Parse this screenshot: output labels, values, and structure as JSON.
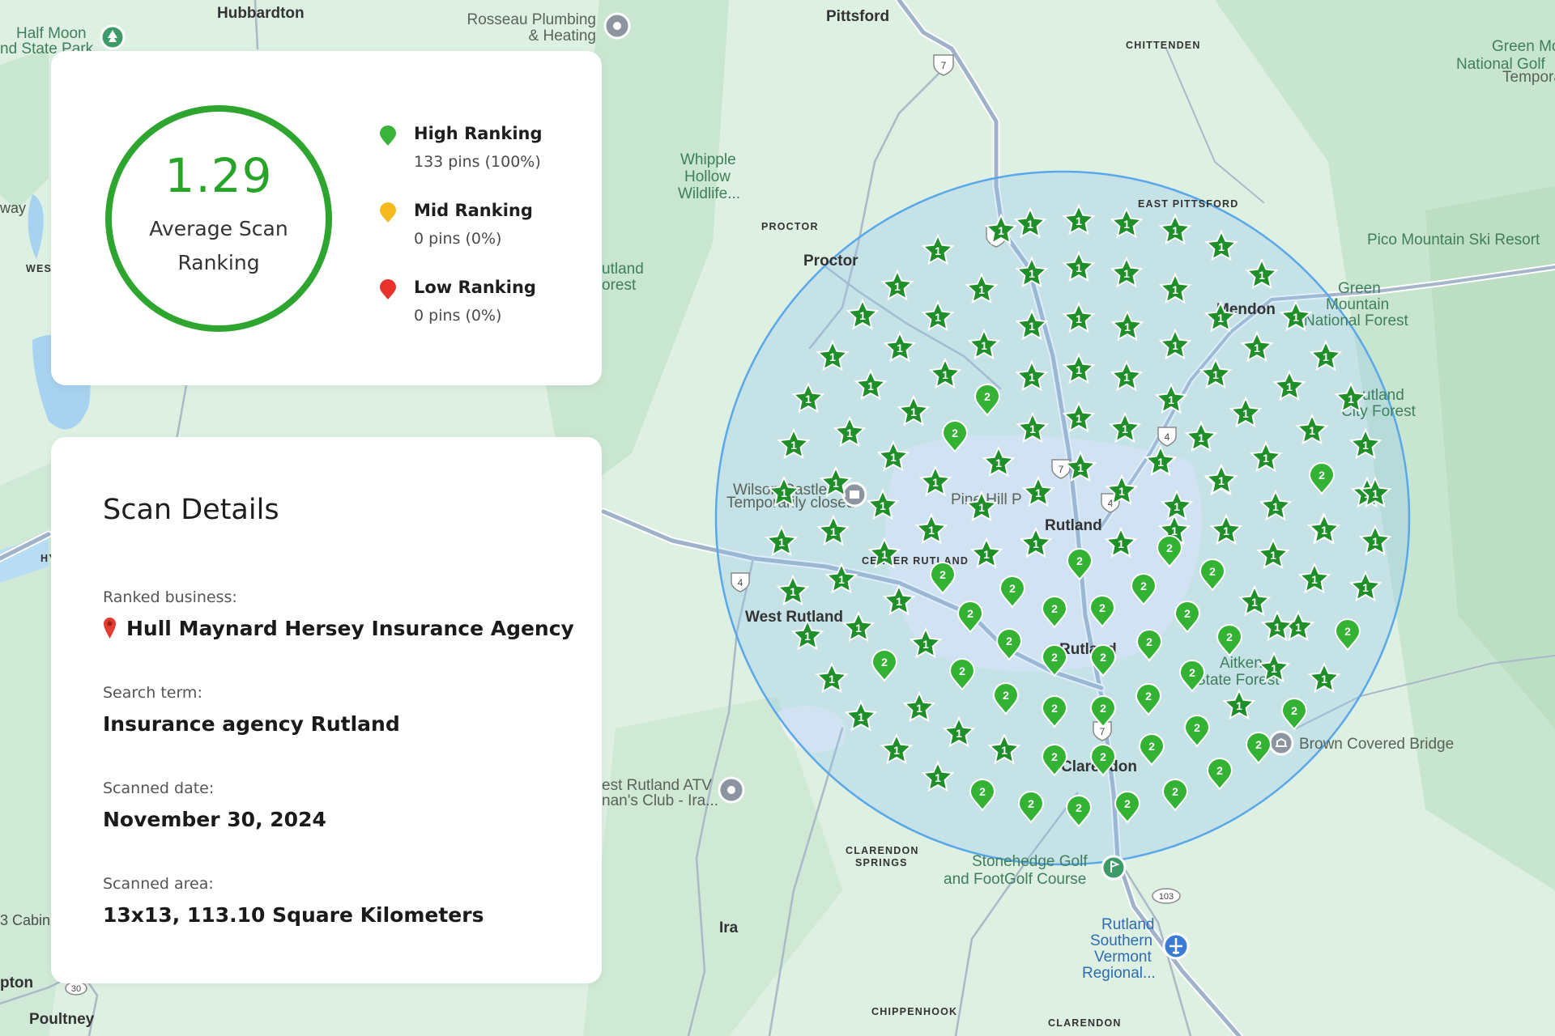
{
  "summary": {
    "score": "1.29",
    "score_caption": "Average Scan Ranking",
    "ring_color": "#2ea52e",
    "legend": [
      {
        "title": "High Ranking",
        "sub": "133 pins (100%)",
        "color": "#39b339"
      },
      {
        "title": "Mid Ranking",
        "sub": "0 pins (0%)",
        "color": "#f6b91e"
      },
      {
        "title": "Low Ranking",
        "sub": "0 pins (0%)",
        "color": "#e8322b"
      }
    ]
  },
  "details": {
    "title": "Scan Details",
    "business_label": "Ranked business:",
    "business_value": "Hull Maynard Hersey Insurance Agency",
    "search_label": "Search term:",
    "search_value": "Insurance agency Rutland",
    "date_label": "Scanned date:",
    "date_value": "November 30, 2024",
    "area_label": "Scanned area:",
    "area_value": "13x13, 113.10 Square Kilometers"
  },
  "map": {
    "place_labels": {
      "hubbardton": "Hubbardton",
      "half_moon_1": "Half Moon",
      "half_moon_2": "nd State Park",
      "rosseau_1": "Rosseau Plumbing",
      "rosseau_2": "& Heating",
      "pittsford": "Pittsford",
      "chittenden": "CHITTENDEN",
      "green_mtn_golf_1": "Green Mo",
      "green_mtn_golf_2": "National Golf",
      "green_mtn_golf_3": "Temporari",
      "way": "way",
      "wes": "WES",
      "whipple_1": "Whipple",
      "whipple_2": "Hollow",
      "whipple_3": "Wildlife...",
      "proctor_caps": "PROCTOR",
      "proctor": "Proctor",
      "east_pittsford": "EAST PITTSFORD",
      "pico": "Pico Mountain Ski Resort",
      "rutland_forest_1": "utland",
      "rutland_forest_2": "orest",
      "mendon": "Mendon",
      "gmnf_1": "Green",
      "gmnf_2": "Mountain",
      "gmnf_3": "National Forest",
      "city_forest_1": "utland",
      "city_forest_2": "City Forest",
      "wilson_1": "Wilson Castle",
      "wilson_2": "Temporarily closed",
      "pine_hill": "Pine Hill P",
      "rutland_city": "Rutland",
      "center_rutland": "CENTER RUTLAND",
      "west_rutland": "West Rutland",
      "rutland_town": "Rutland",
      "aitken_1": "Aitken",
      "aitken_2": "State Forest",
      "brown_bridge": "Brown Covered Bridge",
      "clarendon_town": "Clarendon",
      "atv_1": "est Rutland ATV",
      "atv_2": "nan's Club - Ira...",
      "clarendon_springs_1": "CLARENDON",
      "clarendon_springs_2": "SPRINGS",
      "stonehedge_1": "Stonehedge Golf",
      "stonehedge_2": "and FootGolf Course",
      "airport_1": "Rutland",
      "airport_2": "Southern",
      "airport_3": "Vermont",
      "airport_4": "Regional...",
      "ira": "Ira",
      "cabin": "3 Cabin",
      "pton": "pton",
      "poultney": "Poultney",
      "chippenhook": "CHIPPENHOOK",
      "clarendon_caps": "CLARENDON",
      "hy": "HY"
    },
    "route_shields": {
      "r7": "7",
      "r4": "4",
      "r103": "103",
      "r30": "30"
    },
    "scan_circle_color": "#5aa7ea",
    "pin_color_rank1": "#1f8f2a",
    "pin_color_rank2": "#34b233",
    "pins": [
      {
        "rank": "1",
        "shape": "star",
        "at": [
          1236,
          285
        ]
      },
      {
        "rank": "1",
        "shape": "star",
        "at": [
          1272,
          277
        ]
      },
      {
        "rank": "1",
        "shape": "star",
        "at": [
          1332,
          273
        ]
      },
      {
        "rank": "1",
        "shape": "star",
        "at": [
          1391,
          277
        ]
      },
      {
        "rank": "1",
        "shape": "star",
        "at": [
          1451,
          285
        ]
      },
      {
        "rank": "1",
        "shape": "star",
        "at": [
          1508,
          305
        ]
      },
      {
        "rank": "1",
        "shape": "star",
        "at": [
          1558,
          340
        ]
      },
      {
        "rank": "1",
        "shape": "star",
        "at": [
          1158,
          310
        ]
      },
      {
        "rank": "1",
        "shape": "star",
        "at": [
          1212,
          358
        ]
      },
      {
        "rank": "1",
        "shape": "star",
        "at": [
          1274,
          338
        ]
      },
      {
        "rank": "1",
        "shape": "star",
        "at": [
          1332,
          331
        ]
      },
      {
        "rank": "1",
        "shape": "star",
        "at": [
          1391,
          338
        ]
      },
      {
        "rank": "1",
        "shape": "star",
        "at": [
          1451,
          358
        ]
      },
      {
        "rank": "1",
        "shape": "star",
        "at": [
          1507,
          393
        ]
      },
      {
        "rank": "1",
        "shape": "star",
        "at": [
          1600,
          392
        ]
      },
      {
        "rank": "1",
        "shape": "star",
        "at": [
          1108,
          354
        ]
      },
      {
        "rank": "1",
        "shape": "star",
        "at": [
          1065,
          390
        ]
      },
      {
        "rank": "1",
        "shape": "star",
        "at": [
          1158,
          392
        ]
      },
      {
        "rank": "1",
        "shape": "star",
        "at": [
          1215,
          427
        ]
      },
      {
        "rank": "1",
        "shape": "star",
        "at": [
          1274,
          403
        ]
      },
      {
        "rank": "1",
        "shape": "star",
        "at": [
          1332,
          394
        ]
      },
      {
        "rank": "1",
        "shape": "star",
        "at": [
          1392,
          404
        ]
      },
      {
        "rank": "1",
        "shape": "star",
        "at": [
          1451,
          427
        ]
      },
      {
        "rank": "1",
        "shape": "star",
        "at": [
          1552,
          430
        ]
      },
      {
        "rank": "1",
        "shape": "star",
        "at": [
          1637,
          441
        ]
      },
      {
        "rank": "1",
        "shape": "star",
        "at": [
          1028,
          441
        ]
      },
      {
        "rank": "1",
        "shape": "star",
        "at": [
          1111,
          430
        ]
      },
      {
        "rank": "1",
        "shape": "star",
        "at": [
          1167,
          463
        ]
      },
      {
        "rank": "1",
        "shape": "star",
        "at": [
          1274,
          466
        ]
      },
      {
        "rank": "1",
        "shape": "star",
        "at": [
          1332,
          457
        ]
      },
      {
        "rank": "1",
        "shape": "star",
        "at": [
          1391,
          466
        ]
      },
      {
        "rank": "1",
        "shape": "star",
        "at": [
          1446,
          494
        ]
      },
      {
        "rank": "1",
        "shape": "star",
        "at": [
          1501,
          463
        ]
      },
      {
        "rank": "1",
        "shape": "star",
        "at": [
          1592,
          478
        ]
      },
      {
        "rank": "1",
        "shape": "star",
        "at": [
          1668,
          493
        ]
      },
      {
        "rank": "1",
        "shape": "star",
        "at": [
          998,
          493
        ]
      },
      {
        "rank": "1",
        "shape": "star",
        "at": [
          1075,
          477
        ]
      },
      {
        "rank": "1",
        "shape": "star",
        "at": [
          1128,
          509
        ]
      },
      {
        "rank": "1",
        "shape": "star",
        "at": [
          1275,
          530
        ]
      },
      {
        "rank": "1",
        "shape": "star",
        "at": [
          1332,
          517
        ]
      },
      {
        "rank": "1",
        "shape": "star",
        "at": [
          1389,
          530
        ]
      },
      {
        "rank": "1",
        "shape": "star",
        "at": [
          1483,
          541
        ]
      },
      {
        "rank": "1",
        "shape": "star",
        "at": [
          1538,
          511
        ]
      },
      {
        "rank": "1",
        "shape": "star",
        "at": [
          1620,
          532
        ]
      },
      {
        "rank": "1",
        "shape": "star",
        "at": [
          1686,
          550
        ]
      },
      {
        "rank": "1",
        "shape": "star",
        "at": [
          980,
          550
        ]
      },
      {
        "rank": "1",
        "shape": "star",
        "at": [
          1049,
          535
        ]
      },
      {
        "rank": "1",
        "shape": "star",
        "at": [
          1103,
          565
        ]
      },
      {
        "rank": "1",
        "shape": "star",
        "at": [
          1233,
          572
        ]
      },
      {
        "rank": "1",
        "shape": "star",
        "at": [
          1334,
          578
        ]
      },
      {
        "rank": "1",
        "shape": "star",
        "at": [
          1433,
          571
        ]
      },
      {
        "rank": "1",
        "shape": "star",
        "at": [
          1507,
          595
        ]
      },
      {
        "rank": "1",
        "shape": "star",
        "at": [
          1563,
          566
        ]
      },
      {
        "rank": "1",
        "shape": "star",
        "at": [
          1688,
          610
        ]
      },
      {
        "rank": "1",
        "shape": "star",
        "at": [
          968,
          609
        ]
      },
      {
        "rank": "1",
        "shape": "star",
        "at": [
          1032,
          597
        ]
      },
      {
        "rank": "1",
        "shape": "star",
        "at": [
          1090,
          625
        ]
      },
      {
        "rank": "1",
        "shape": "star",
        "at": [
          1155,
          596
        ]
      },
      {
        "rank": "1",
        "shape": "star",
        "at": [
          1212,
          627
        ]
      },
      {
        "rank": "1",
        "shape": "star",
        "at": [
          1282,
          609
        ]
      },
      {
        "rank": "1",
        "shape": "star",
        "at": [
          1385,
          607
        ]
      },
      {
        "rank": "1",
        "shape": "star",
        "at": [
          1453,
          626
        ]
      },
      {
        "rank": "1",
        "shape": "star",
        "at": [
          1508,
          594
        ]
      },
      {
        "rank": "1",
        "shape": "star",
        "at": [
          1575,
          626
        ]
      },
      {
        "rank": "1",
        "shape": "star",
        "at": [
          1634,
          655
        ]
      },
      {
        "rank": "1",
        "shape": "star",
        "at": [
          1698,
          610
        ]
      },
      {
        "rank": "1",
        "shape": "star",
        "at": [
          965,
          670
        ]
      },
      {
        "rank": "1",
        "shape": "star",
        "at": [
          1029,
          657
        ]
      },
      {
        "rank": "1",
        "shape": "star",
        "at": [
          1092,
          685
        ]
      },
      {
        "rank": "1",
        "shape": "star",
        "at": [
          1150,
          655
        ]
      },
      {
        "rank": "1",
        "shape": "star",
        "at": [
          1218,
          685
        ]
      },
      {
        "rank": "1",
        "shape": "star",
        "at": [
          1279,
          672
        ]
      },
      {
        "rank": "1",
        "shape": "star",
        "at": [
          1384,
          672
        ]
      },
      {
        "rank": "1",
        "shape": "star",
        "at": [
          1450,
          656
        ]
      },
      {
        "rank": "1",
        "shape": "star",
        "at": [
          1514,
          656
        ]
      },
      {
        "rank": "1",
        "shape": "star",
        "at": [
          1572,
          686
        ]
      },
      {
        "rank": "1",
        "shape": "star",
        "at": [
          1635,
          655
        ]
      },
      {
        "rank": "1",
        "shape": "star",
        "at": [
          1698,
          669
        ]
      },
      {
        "rank": "1",
        "shape": "star",
        "at": [
          979,
          731
        ]
      },
      {
        "rank": "1",
        "shape": "star",
        "at": [
          1039,
          716
        ]
      },
      {
        "rank": "1",
        "shape": "star",
        "at": [
          1110,
          743
        ]
      },
      {
        "rank": "1",
        "shape": "star",
        "at": [
          1143,
          796
        ]
      },
      {
        "rank": "1",
        "shape": "star",
        "at": [
          1060,
          776
        ]
      },
      {
        "rank": "1",
        "shape": "star",
        "at": [
          997,
          786
        ]
      },
      {
        "rank": "1",
        "shape": "star",
        "at": [
          1549,
          744
        ]
      },
      {
        "rank": "1",
        "shape": "star",
        "at": [
          1603,
          775
        ]
      },
      {
        "rank": "1",
        "shape": "star",
        "at": [
          1623,
          716
        ]
      },
      {
        "rank": "1",
        "shape": "star",
        "at": [
          1686,
          726
        ]
      },
      {
        "rank": "1",
        "shape": "star",
        "at": [
          1027,
          839
        ]
      },
      {
        "rank": "1",
        "shape": "star",
        "at": [
          1063,
          886
        ]
      },
      {
        "rank": "1",
        "shape": "star",
        "at": [
          1135,
          875
        ]
      },
      {
        "rank": "1",
        "shape": "star",
        "at": [
          1184,
          906
        ]
      },
      {
        "rank": "1",
        "shape": "star",
        "at": [
          1107,
          927
        ]
      },
      {
        "rank": "1",
        "shape": "star",
        "at": [
          1158,
          961
        ]
      },
      {
        "rank": "1",
        "shape": "star",
        "at": [
          1240,
          927
        ]
      },
      {
        "rank": "1",
        "shape": "star",
        "at": [
          1530,
          872
        ]
      },
      {
        "rank": "1",
        "shape": "star",
        "at": [
          1573,
          826
        ]
      },
      {
        "rank": "1",
        "shape": "star",
        "at": [
          1635,
          839
        ]
      },
      {
        "rank": "1",
        "shape": "star",
        "at": [
          1577,
          775
        ]
      },
      {
        "rank": "2",
        "shape": "pin",
        "at": [
          1219,
          495
        ]
      },
      {
        "rank": "2",
        "shape": "pin",
        "at": [
          1179,
          540
        ]
      },
      {
        "rank": "2",
        "shape": "pin",
        "at": [
          1164,
          715
        ]
      },
      {
        "rank": "2",
        "shape": "pin",
        "at": [
          1250,
          732
        ]
      },
      {
        "rank": "2",
        "shape": "pin",
        "at": [
          1333,
          698
        ]
      },
      {
        "rank": "2",
        "shape": "pin",
        "at": [
          1444,
          682
        ]
      },
      {
        "rank": "2",
        "shape": "pin",
        "at": [
          1497,
          711
        ]
      },
      {
        "rank": "2",
        "shape": "pin",
        "at": [
          1632,
          592
        ]
      },
      {
        "rank": "2",
        "shape": "pin",
        "at": [
          1412,
          729
        ]
      },
      {
        "rank": "2",
        "shape": "pin",
        "at": [
          1302,
          757
        ]
      },
      {
        "rank": "2",
        "shape": "pin",
        "at": [
          1361,
          756
        ]
      },
      {
        "rank": "2",
        "shape": "pin",
        "at": [
          1198,
          763
        ]
      },
      {
        "rank": "2",
        "shape": "pin",
        "at": [
          1246,
          797
        ]
      },
      {
        "rank": "2",
        "shape": "pin",
        "at": [
          1302,
          817
        ]
      },
      {
        "rank": "2",
        "shape": "pin",
        "at": [
          1362,
          817
        ]
      },
      {
        "rank": "2",
        "shape": "pin",
        "at": [
          1419,
          798
        ]
      },
      {
        "rank": "2",
        "shape": "pin",
        "at": [
          1466,
          763
        ]
      },
      {
        "rank": "2",
        "shape": "pin",
        "at": [
          1518,
          792
        ]
      },
      {
        "rank": "2",
        "shape": "pin",
        "at": [
          1664,
          785
        ]
      },
      {
        "rank": "2",
        "shape": "pin",
        "at": [
          1092,
          823
        ]
      },
      {
        "rank": "2",
        "shape": "pin",
        "at": [
          1188,
          834
        ]
      },
      {
        "rank": "2",
        "shape": "pin",
        "at": [
          1242,
          864
        ]
      },
      {
        "rank": "2",
        "shape": "pin",
        "at": [
          1302,
          880
        ]
      },
      {
        "rank": "2",
        "shape": "pin",
        "at": [
          1362,
          880
        ]
      },
      {
        "rank": "2",
        "shape": "pin",
        "at": [
          1418,
          865
        ]
      },
      {
        "rank": "2",
        "shape": "pin",
        "at": [
          1472,
          836
        ]
      },
      {
        "rank": "2",
        "shape": "pin",
        "at": [
          1598,
          883
        ]
      },
      {
        "rank": "2",
        "shape": "pin",
        "at": [
          1302,
          940
        ]
      },
      {
        "rank": "2",
        "shape": "pin",
        "at": [
          1362,
          940
        ]
      },
      {
        "rank": "2",
        "shape": "pin",
        "at": [
          1422,
          927
        ]
      },
      {
        "rank": "2",
        "shape": "pin",
        "at": [
          1478,
          904
        ]
      },
      {
        "rank": "2",
        "shape": "pin",
        "at": [
          1554,
          925
        ]
      },
      {
        "rank": "2",
        "shape": "pin",
        "at": [
          1506,
          957
        ]
      },
      {
        "rank": "2",
        "shape": "pin",
        "at": [
          1213,
          983
        ]
      },
      {
        "rank": "2",
        "shape": "pin",
        "at": [
          1273,
          998
        ]
      },
      {
        "rank": "2",
        "shape": "pin",
        "at": [
          1332,
          1003
        ]
      },
      {
        "rank": "2",
        "shape": "pin",
        "at": [
          1392,
          998
        ]
      },
      {
        "rank": "2",
        "shape": "pin",
        "at": [
          1451,
          983
        ]
      }
    ]
  }
}
